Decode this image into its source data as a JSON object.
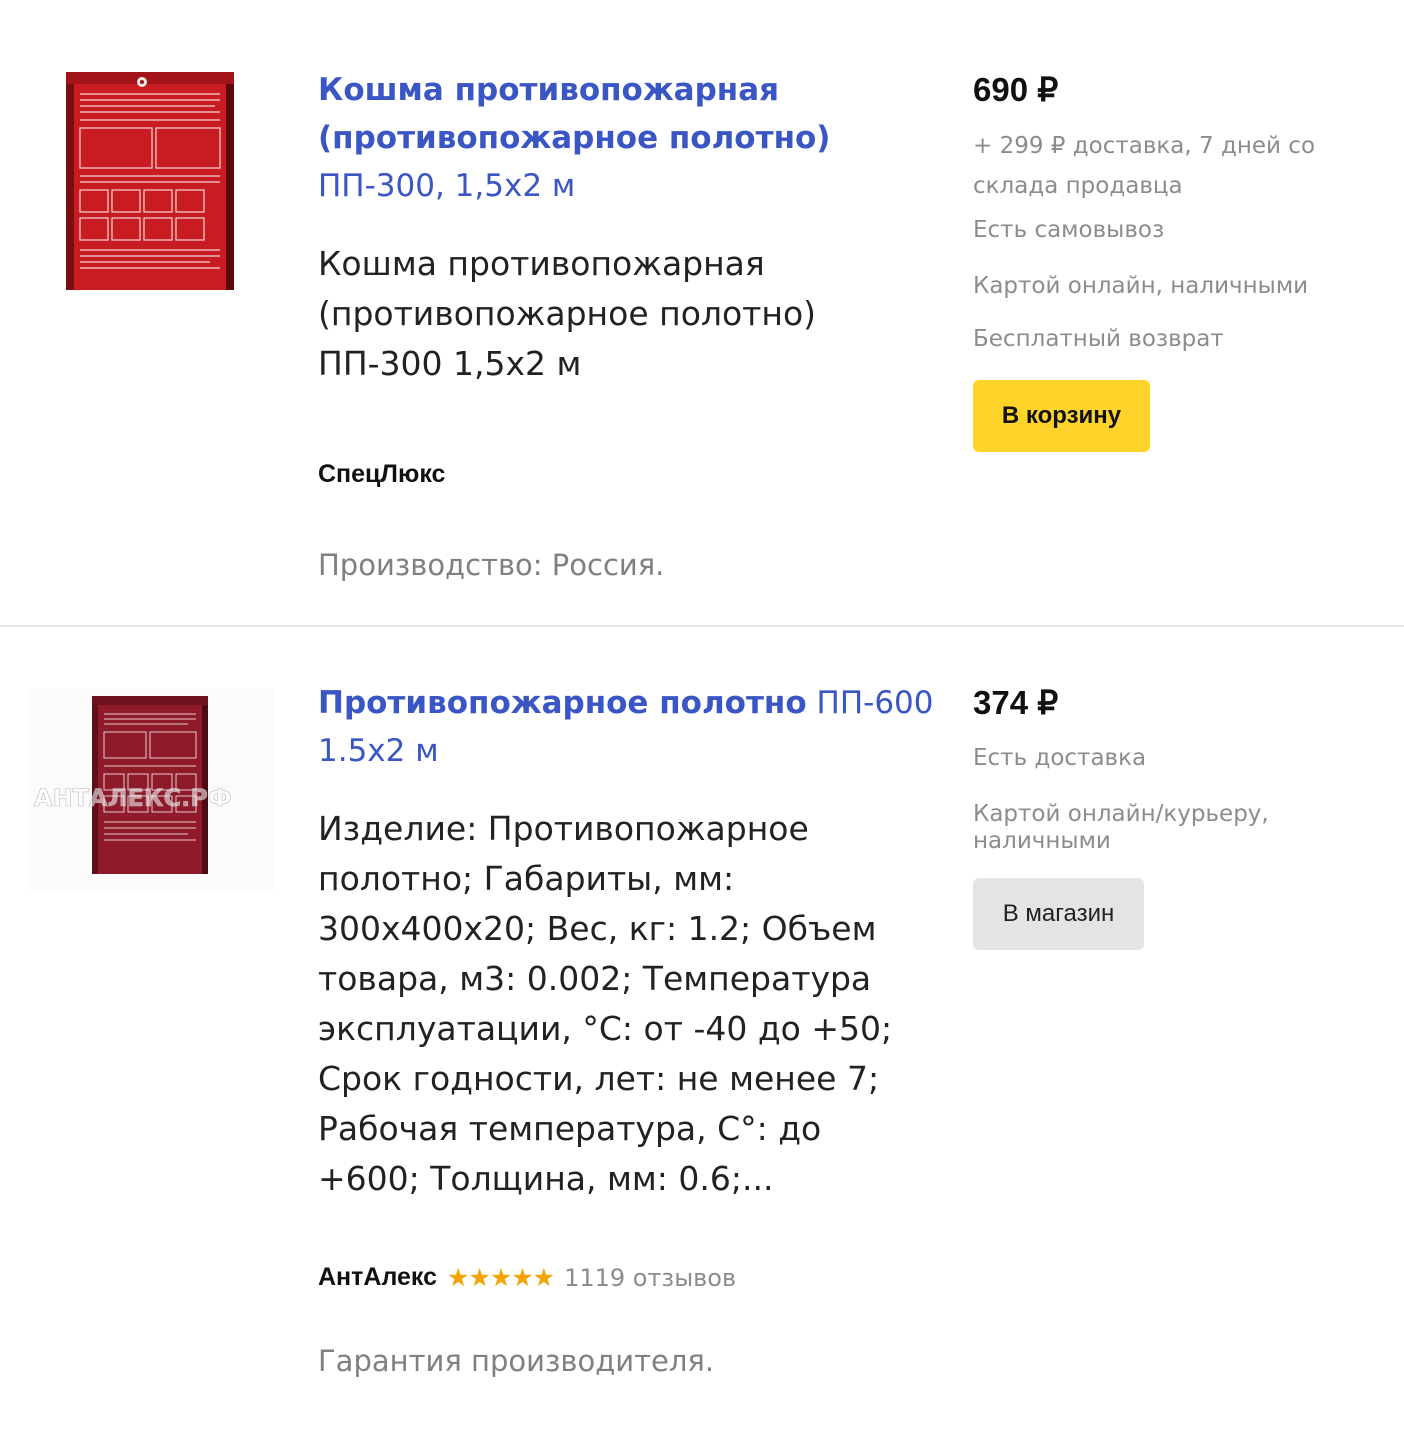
{
  "offers": [
    {
      "title_bold": "Кошма противопожарная (противопожарное полотно)",
      "title_rest": "ПП-300, 1,5х2 м",
      "description_lines": [
        "Кошма противопожарная",
        "(противопожарное полотно)",
        "ПП-300 1,5х2 м"
      ],
      "shop": "СпецЛюкс",
      "note": "Производство: Россия.",
      "price": "690 ₽",
      "delivery_lines": [
        "+ 299 ₽ доставка, 7 дней  со",
        "склада продавца"
      ],
      "pickup": "Есть самовывоз",
      "payment": "Картой онлайн, наличными",
      "return": "Бесплатный возврат",
      "button": "В корзину",
      "colors": {
        "button_bg": "#fed42b"
      }
    },
    {
      "title_bold": "Противопожарное полотно",
      "title_rest_1": "ПП-600",
      "title_rest_2": "1.5х2 м",
      "description_lines": [
        "Изделие: Противопожарное",
        "полотно; Габариты, мм:",
        "300x400x20; Вес, кг: 1.2; Объем",
        "товара, м3:  0.002; Температура",
        "эксплуатации, °С: от -40 до +50;",
        "Срок годности, лет: не менее 7;",
        "Рабочая температура, С°: до",
        "+600; Толщина, мм: 0.6;..."
      ],
      "shop": "АнтАлекс",
      "rating_stars": "★★★★★",
      "rating_value": 5,
      "reviews": "1119 отзывов",
      "note": "Гарантия производителя.",
      "price": "374 ₽",
      "delivery": "Есть доставка",
      "payment_lines": [
        "Картой онлайн/курьеру,",
        "наличными"
      ],
      "button": "В магазин",
      "image_watermark": "АНТАЛЕКС.РФ",
      "colors": {
        "button_bg": "#e4e4e4",
        "stars": "#f5a300"
      }
    }
  ],
  "colors": {
    "link": "#3a55c4",
    "muted": "#8c8c8c",
    "divider": "#e6e6e6"
  }
}
